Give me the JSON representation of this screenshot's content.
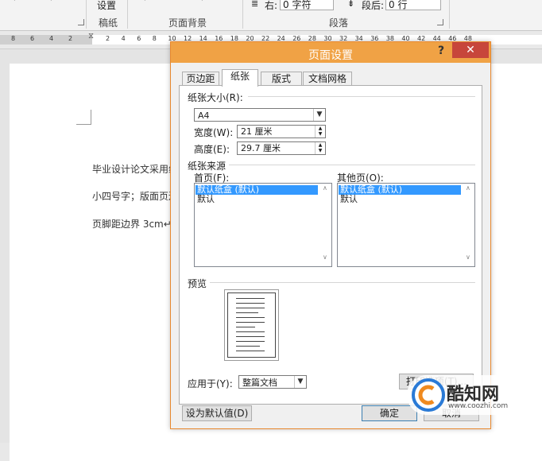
{
  "ribbon": {
    "group_draft_btn": "设置",
    "group_draft_label": "稿纸",
    "group_bg_label": "页面背景",
    "group_para_label": "段落",
    "indent_right_label": "右:",
    "indent_right_value": "0 字符",
    "spacing_after_label": "段后:",
    "spacing_after_value": "0 行"
  },
  "ruler": {
    "labels": [
      "8",
      "6",
      "4",
      "2",
      "2",
      "4",
      "6",
      "8",
      "10",
      "12",
      "14",
      "16",
      "18",
      "20",
      "22",
      "24",
      "26",
      "28",
      "30",
      "32",
      "34",
      "36",
      "38",
      "40",
      "42",
      "44",
      "46",
      "48"
    ]
  },
  "document": {
    "lines": [
      "毕业设计论文采用纸",
      "小四号字；版面页边",
      "页脚距边界 3cm↵"
    ]
  },
  "dialog": {
    "title": "页面设置",
    "help": "?",
    "close": "✕",
    "tabs": [
      "页边距",
      "纸张",
      "版式",
      "文档网格"
    ],
    "active_tab": "纸张",
    "paper_size_label": "纸张大小(R):",
    "paper_size_value": "A4",
    "width_label": "宽度(W):",
    "width_value": "21 厘米",
    "height_label": "高度(E):",
    "height_value": "29.7 厘米",
    "paper_source_label": "纸张来源",
    "first_page_label": "首页(F):",
    "first_page_items": [
      "默认纸盒 (默认)",
      "默认"
    ],
    "other_pages_label": "其他页(O):",
    "other_pages_items": [
      "默认纸盒 (默认)",
      "默认"
    ],
    "preview_label": "预览",
    "apply_to_label": "应用于(Y):",
    "apply_to_value": "整篇文档",
    "print_options_btn": "打印选项(T)...",
    "set_default_btn": "设为默认值(D)",
    "ok_btn": "确定",
    "cancel_btn": "取消"
  },
  "watermark": {
    "name": "酷知网",
    "url": "www.coozhi.com"
  },
  "colors": {
    "titlebar": "#f0a245",
    "close": "#c7463b",
    "selection": "#3399ff"
  }
}
